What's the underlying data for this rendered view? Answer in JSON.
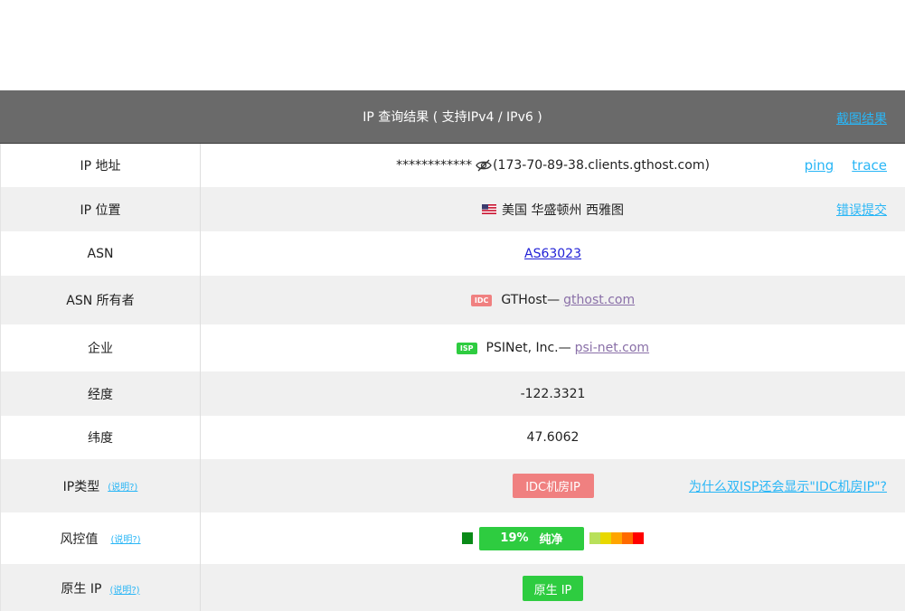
{
  "header": {
    "title": "IP 查询结果 ( 支持IPv4 / IPv6 )",
    "screenshot_link": "截图结果"
  },
  "rows": {
    "ip": {
      "label": "IP 地址",
      "masked": "************",
      "hostname": "(173-70-89-38.clients.gthost.com)",
      "ping": "ping",
      "trace": "trace"
    },
    "location": {
      "label": "IP 位置",
      "value": "美国 华盛顿州 西雅图",
      "report": "错误提交"
    },
    "asn": {
      "label": "ASN",
      "value": "AS63023"
    },
    "asn_owner": {
      "label": "ASN 所有者",
      "badge": "IDC",
      "name": "GTHost—",
      "domain": "gthost.com"
    },
    "company": {
      "label": "企业",
      "badge": "ISP",
      "name": "PSINet, Inc.—",
      "domain": "psi-net.com"
    },
    "longitude": {
      "label": "经度",
      "value": "-122.3321"
    },
    "latitude": {
      "label": "纬度",
      "value": "47.6062"
    },
    "ip_type": {
      "label": "IP类型",
      "help": "(说明?)",
      "value": "IDC机房IP",
      "question": "为什么双ISP还会显示\"IDC机房IP\"?"
    },
    "risk": {
      "label": "风控值",
      "help": "(说明?)",
      "percent": "19%",
      "status": "纯净",
      "scale_colors": [
        "#b8e05a",
        "#e8d800",
        "#ffa500",
        "#ff6a00",
        "#ff0000"
      ]
    },
    "native": {
      "label": "原生 IP",
      "help": "(说明?)",
      "value": "原生 IP"
    }
  },
  "colors": {
    "header_bg": "#6a6a6a",
    "link": "#29b6f6",
    "green": "#2ecc40",
    "idc_red": "#f08080"
  }
}
